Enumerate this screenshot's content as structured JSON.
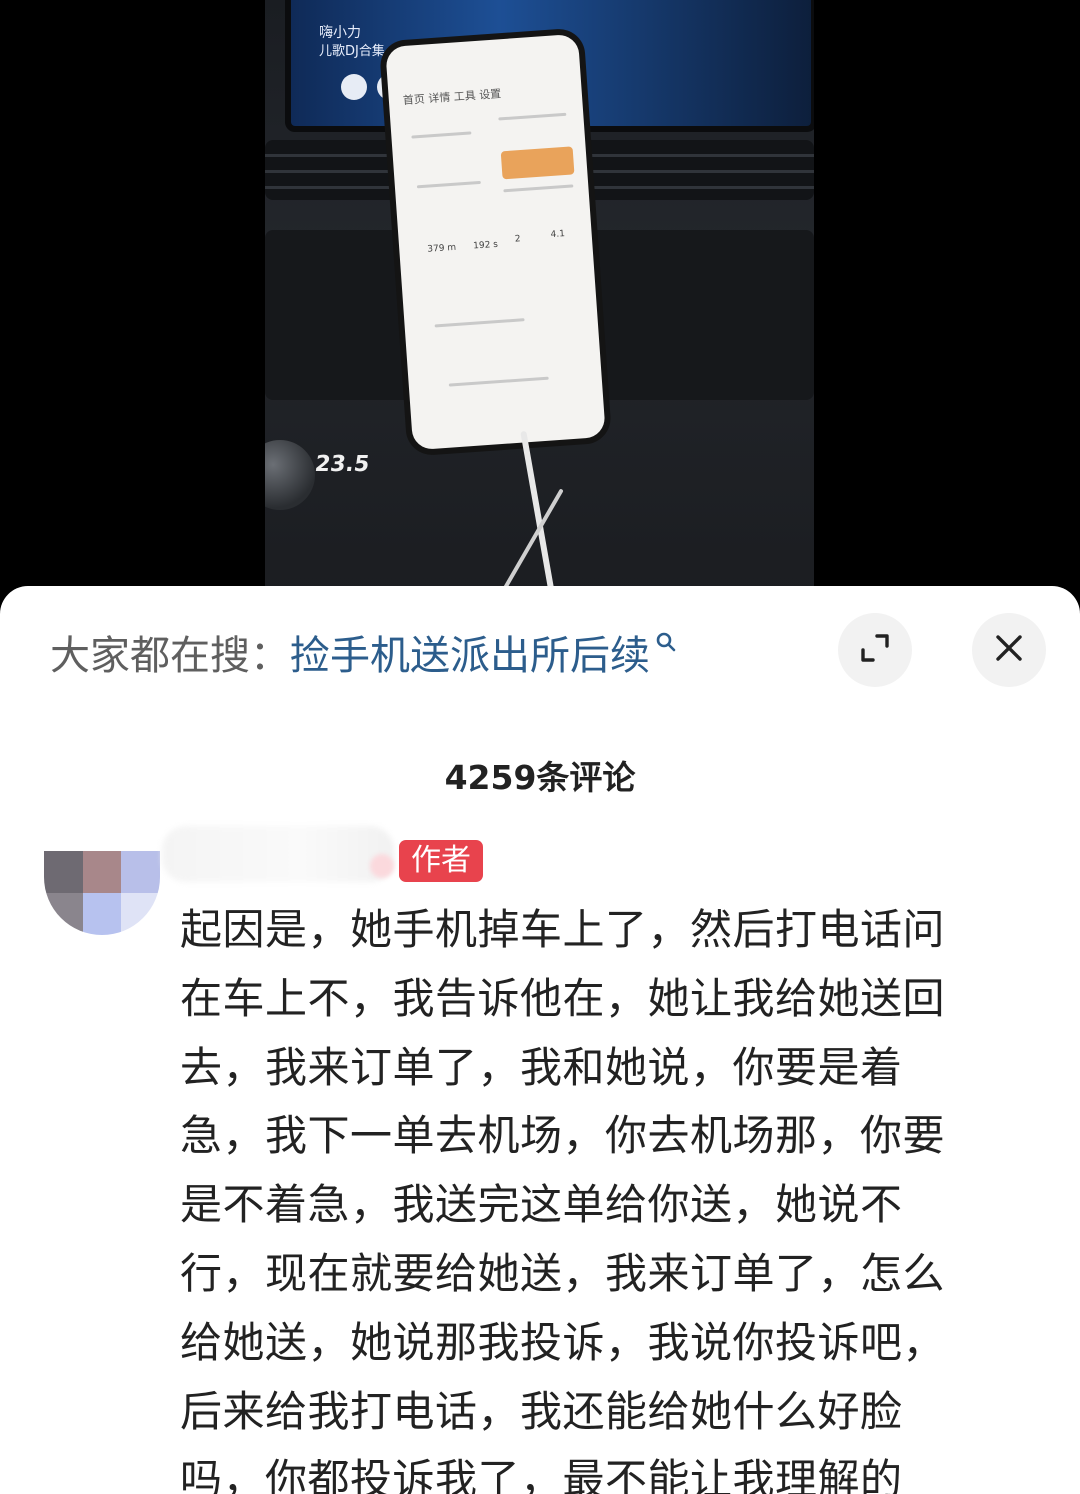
{
  "video": {
    "dash_song_title": "嗨小力",
    "dash_song_subtitle": "儿歌DJ合集 (DJ串烧...",
    "car_temperature": "23.5",
    "phone_tabs": "首页  详情  工具  设置",
    "phone_stats": [
      "379 m",
      "192 s",
      "2",
      "4.1"
    ]
  },
  "search": {
    "prefix": "大家都在搜：",
    "term": "捡手机送派出所后续"
  },
  "comments_header": {
    "count_label": "4259条评论"
  },
  "comment": {
    "author_badge": "作者",
    "lines": [
      "起因是，她手机掉车上了，然后打电话问",
      "在车上不，我告诉他在，她让我给她送回",
      "去，我来订单了，我和她说，你要是着",
      "急，我下一单去机场，你去机场那，你要",
      "是不着急，我送完这单给你送，她说不",
      "行，现在就要给她送，我来订单了，怎么",
      "给她送，她说那我投诉，我说你投诉吧，",
      "后来给我打电话，我还能给她什么好脸",
      "吗，你都投诉我了，最不能让我理解的"
    ]
  },
  "colors": {
    "search_term": "#2c5d8c",
    "author_badge_bg": "#e8434d",
    "sheet_bg": "#ffffff",
    "button_bg": "#f2f2f2"
  },
  "icons": [
    "search-icon",
    "expand-icon",
    "close-icon"
  ]
}
